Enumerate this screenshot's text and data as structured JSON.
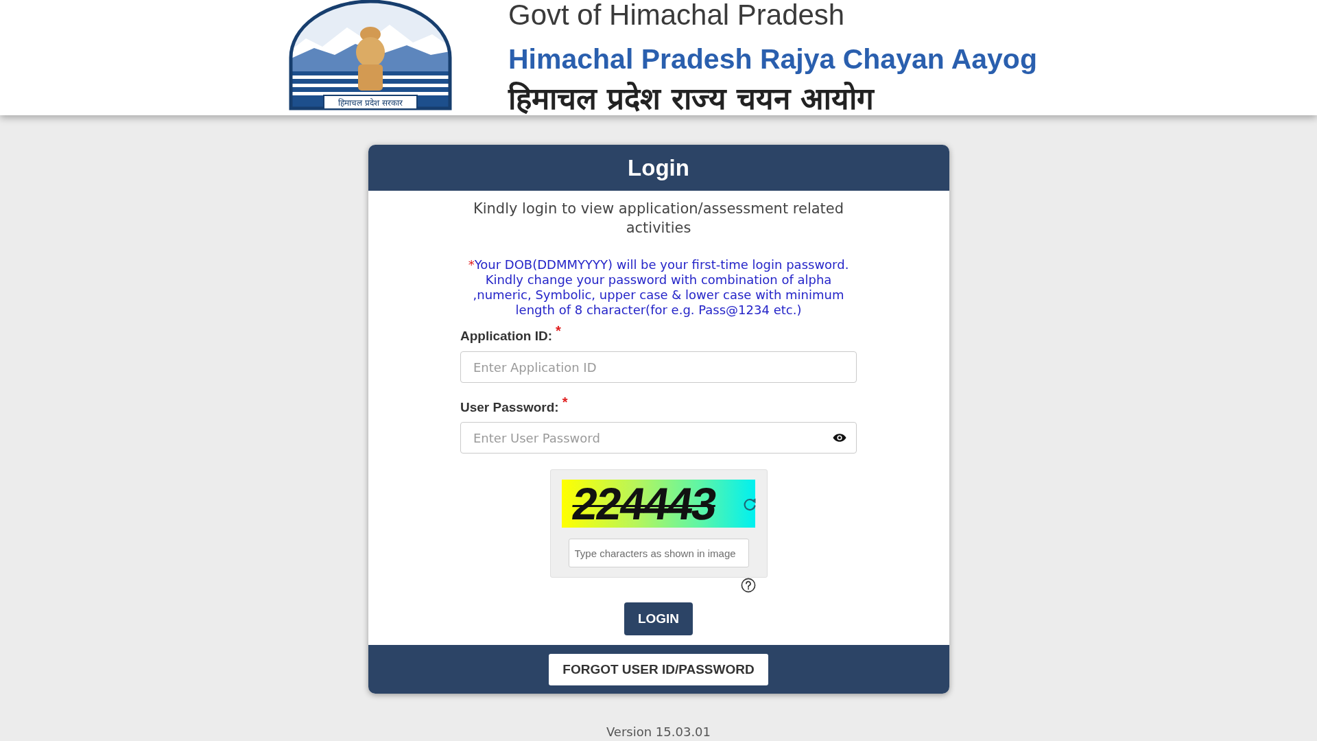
{
  "header": {
    "logo_caption": "हिमाचल प्रदेश सरकार",
    "line_1": "Govt of Himachal Pradesh",
    "line_2": "Himachal Pradesh Rajya Chayan Aayog",
    "line_3": "हिमाचल प्रदेश राज्य चयन आयोग"
  },
  "login_card": {
    "title": "Login",
    "intro": "Kindly login to view application/assessment related activities",
    "note": {
      "mark": "*",
      "text": "Your DOB(DDMMYYYY) will be your first-time login password. Kindly change your password with combination of alpha ,numeric, Symbolic, upper case & lower case with minimum length of 8 character(for e.g. Pass@1234 etc.)"
    },
    "fields": [
      {
        "kind": "text",
        "label": "Application ID:",
        "required_mark": "*",
        "placeholder": "Enter Application ID"
      },
      {
        "kind": "password",
        "label": "User Password:",
        "required_mark": "*",
        "placeholder": "Enter User Password"
      }
    ],
    "captcha": {
      "code": "224443",
      "placeholder": "Type characters as shown in image"
    },
    "login_button": "LOGIN",
    "forgot_button": "FORGOT USER ID/PASSWORD"
  },
  "version": "Version 15.03.01"
}
